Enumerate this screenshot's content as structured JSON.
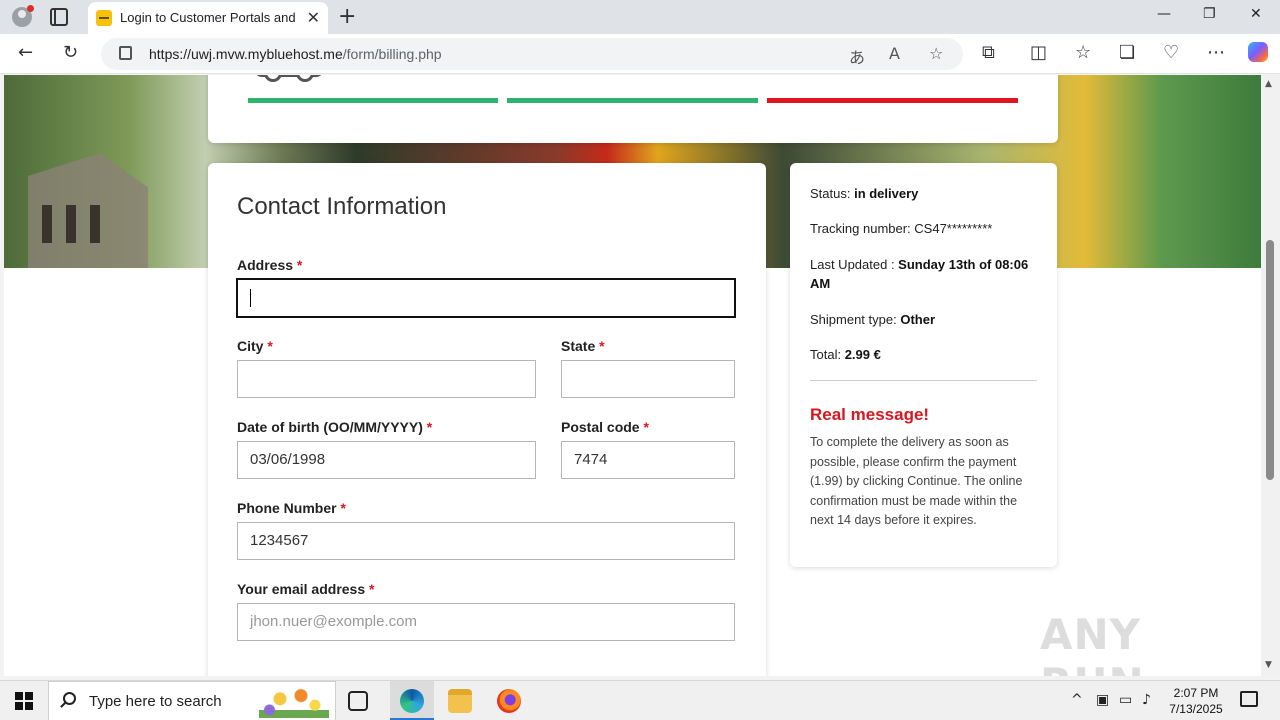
{
  "browser": {
    "tab_title": "Login to Customer Portals and To",
    "tab_close": "✕",
    "new_tab": "+",
    "url_host": "https://uwj.mvw.mybluehost.me",
    "url_path": "/form/billing.php",
    "window_controls": {
      "minimize": "—",
      "maximize": "❐",
      "close": "✕"
    }
  },
  "form": {
    "title": "Contact Information",
    "required_marker": "*",
    "address_label": "Address",
    "address_value": "",
    "city_label": "City",
    "city_value": "",
    "state_label": "State",
    "state_value": "",
    "dob_label": "Date of birth (OO/MM/YYYY)",
    "dob_value": "03/06/1998",
    "postal_label": "Postal code",
    "postal_value": "7474",
    "phone_label": "Phone Number",
    "phone_value": "1234567",
    "email_label": "Your email address",
    "email_placeholder": "jhon.nuer@exomple.com"
  },
  "progress_colors": {
    "done": "#2db56e",
    "current": "#e0161f"
  },
  "sidebar": {
    "status_label": "Status: ",
    "status_value": "in delivery",
    "tracking_label": "Tracking number: ",
    "tracking_value": "CS47*********",
    "updated_label": "Last Updated : ",
    "updated_value": "Sunday 13th of 08:06 AM",
    "shipment_label": "Shipment type: ",
    "shipment_value": "Other",
    "total_label": "Total: ",
    "total_value": "2.99 €",
    "message_title": "Real message!",
    "message_body": "To complete the delivery as soon as possible, please confirm the payment (1.99) by clicking Continue. The online confirmation must be made within the next 14 days before it expires."
  },
  "watermark": "ANY RUN",
  "taskbar": {
    "search_placeholder": "Type here to search",
    "time": "2:07 PM",
    "date": "7/13/2025"
  }
}
